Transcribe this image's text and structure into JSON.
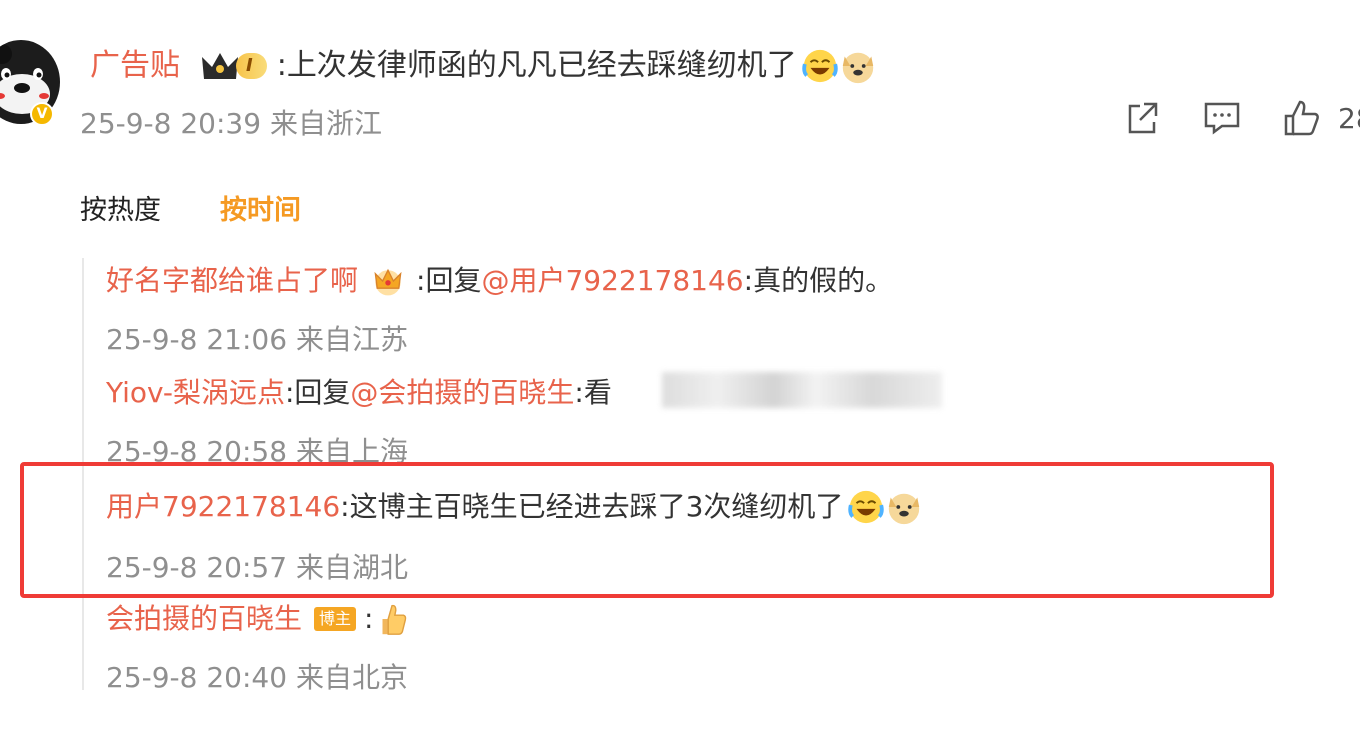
{
  "post": {
    "author": "广告贴",
    "vip_level": "I",
    "separator": ":",
    "text": "上次发律师函的凡凡已经去踩缝纫机了",
    "time": "25-9-8 20:39",
    "location": "来自浙江",
    "like_count": "28"
  },
  "sort": {
    "hot_label": "按热度",
    "time_label": "按时间"
  },
  "replies": [
    {
      "author": "好名字都给谁占了啊",
      "separator": ":",
      "reply_prefix": "回复",
      "mention": "@用户7922178146",
      "colon": ":",
      "text": "真的假的。",
      "time": "25-9-8 21:06",
      "location": "来自江苏"
    },
    {
      "author": "Yiov-梨涡远点",
      "separator": ":",
      "reply_prefix": "回复",
      "mention": "@会拍摄的百晓生",
      "colon": ":",
      "text": "看",
      "time": "25-9-8 20:58",
      "location": "来自上海"
    },
    {
      "author": "用户7922178146",
      "separator": ":",
      "text": "这博主百晓生已经进去踩了3次缝纫机了",
      "time": "25-9-8 20:57",
      "location": "来自湖北"
    },
    {
      "author": "会拍摄的百晓生",
      "badge": "博主",
      "separator": ":",
      "time": "25-9-8 20:40",
      "location": "来自北京"
    }
  ],
  "icons": [
    "share-icon",
    "comment-icon",
    "like-icon",
    "laugh-cry-emoji",
    "doge-emoji",
    "crown-icon",
    "thumbs-up-emoji"
  ],
  "colors": {
    "username": "#e8634b",
    "active_sort": "#f59a23",
    "meta": "#8f8f8f",
    "highlight_border": "#ef3b36"
  }
}
